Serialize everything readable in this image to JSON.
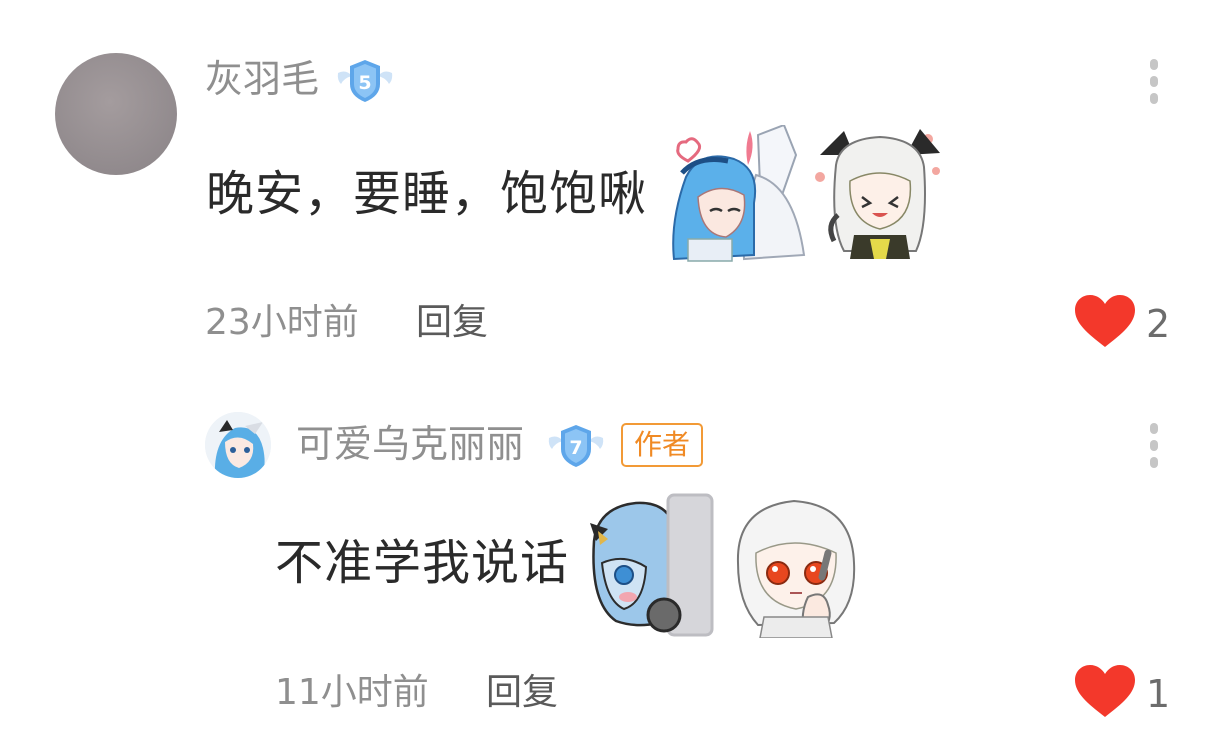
{
  "comment": {
    "username": "灰羽毛",
    "level": "5",
    "text": "晚安，要睡，饱饱啾",
    "time": "23小时前",
    "reply_label": "回复",
    "likes": "2"
  },
  "reply": {
    "username": "可爱乌克丽丽",
    "level": "7",
    "author_tag": "作者",
    "text": "不准学我说话",
    "time": "11小时前",
    "reply_label": "回复",
    "likes": "1"
  },
  "icons": {
    "like": "heart-icon",
    "more": "more-vertical-icon",
    "level": "level-shield-icon"
  },
  "colors": {
    "heart": "#f3382b",
    "author_tag": "#f29a36",
    "level_badge": "#5ea6ea",
    "muted_text": "#8f8f8f"
  }
}
